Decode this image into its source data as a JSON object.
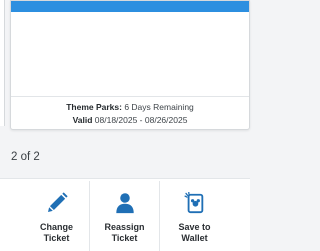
{
  "ticket": {
    "parks_label": "Theme Parks:",
    "parks_value": "6 Days Remaining",
    "valid_label": "Valid",
    "valid_value": "08/18/2025 - 08/26/2025",
    "header_color": "#2c8fe0"
  },
  "pager": {
    "text": "2 of 2"
  },
  "actions": [
    {
      "line1": "Change",
      "line2": "Ticket",
      "icon": "pencil-icon"
    },
    {
      "line1": "Reassign",
      "line2": "Ticket",
      "icon": "person-icon"
    },
    {
      "line1": "Save to",
      "line2": "Wallet",
      "icon": "wallet-pass-icon"
    }
  ],
  "colors": {
    "accent": "#1f6fb5",
    "header": "#2c8fe0"
  }
}
